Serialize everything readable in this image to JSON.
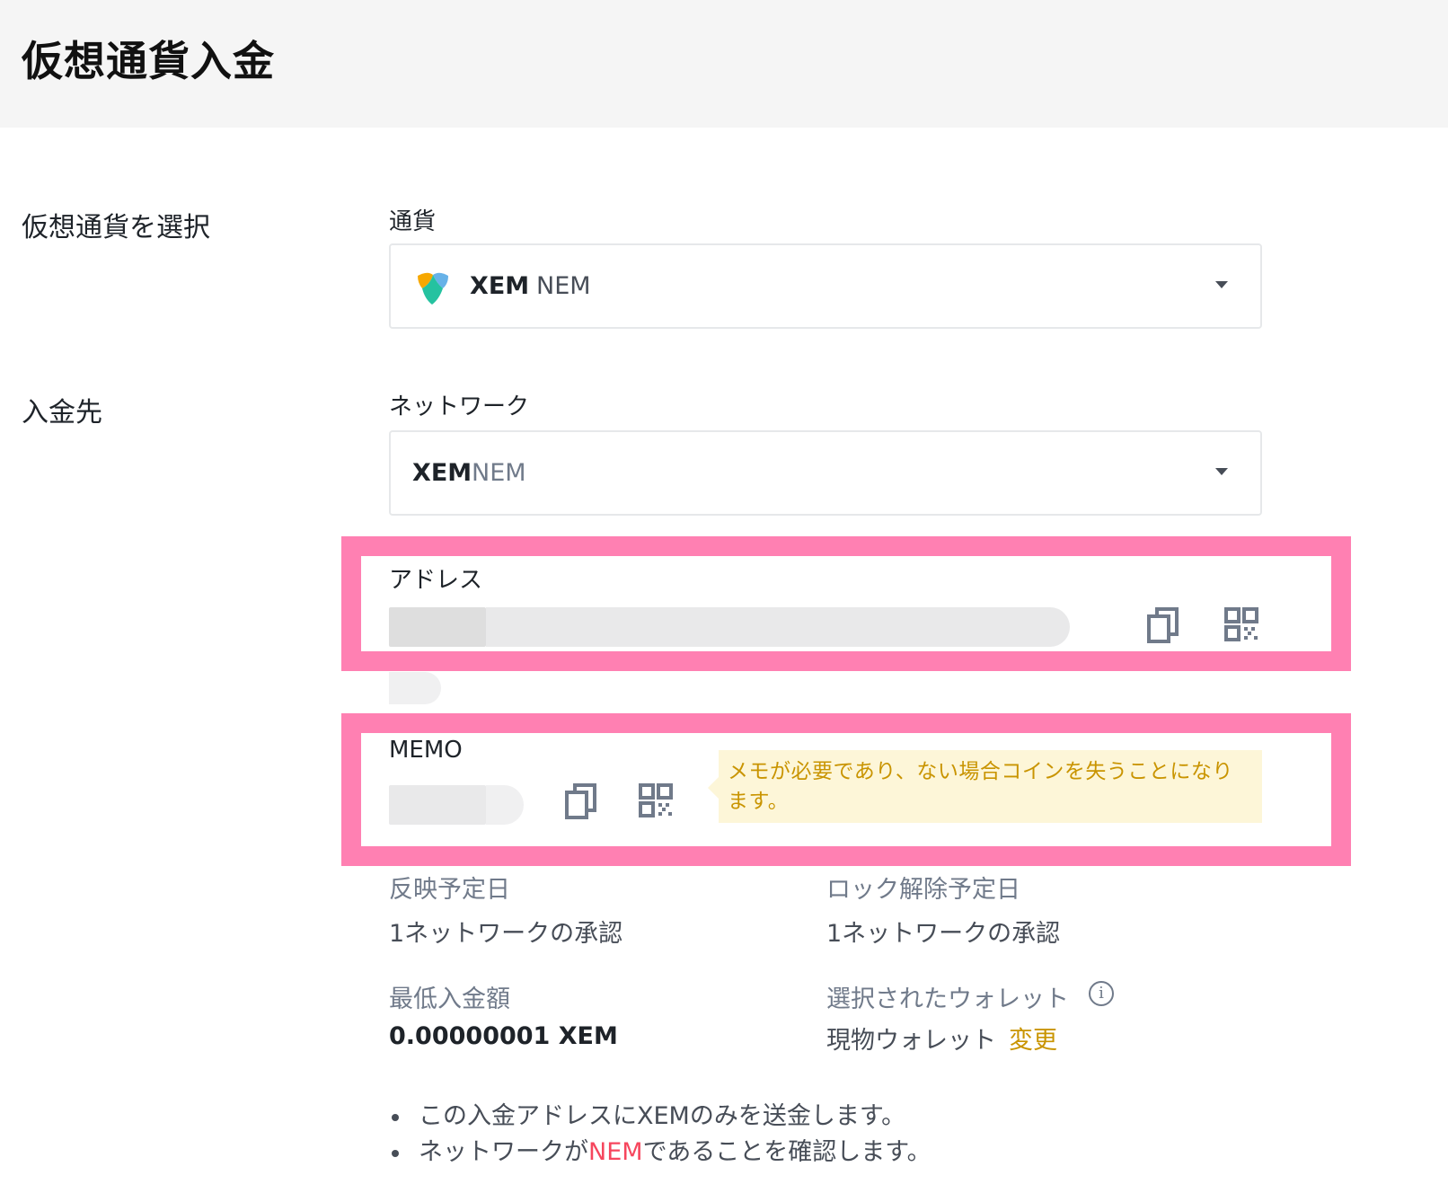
{
  "header": {
    "title": "仮想通貨入金"
  },
  "select_crypto": {
    "section_label": "仮想通貨を選択",
    "field_label": "通貨",
    "selected_code": "XEM",
    "selected_name": "NEM",
    "logo_icon": "nem-logo-icon"
  },
  "deposit_to": {
    "section_label": "入金先",
    "network_label": "ネットワーク",
    "network_code": "XEM",
    "network_name": "NEM"
  },
  "address": {
    "label": "アドレス",
    "copy_icon": "copy-icon",
    "qr_icon": "qr-code-icon"
  },
  "memo": {
    "label": "MEMO",
    "copy_icon": "copy-icon",
    "qr_icon": "qr-code-icon",
    "warning": "メモが必要であり、ない場合コインを失うことになります。"
  },
  "details": {
    "expected_arrival_label": "反映予定日",
    "expected_arrival_value": "1ネットワークの承認",
    "expected_unlock_label": "ロック解除予定日",
    "expected_unlock_value": "1ネットワークの承認",
    "min_deposit_label": "最低入金額",
    "min_deposit_value": "0.00000001 XEM",
    "selected_wallet_label": "選択されたウォレット",
    "selected_wallet_value": "現物ウォレット",
    "change_label": "変更",
    "info_icon": "info-icon"
  },
  "notes": [
    {
      "before": "この入金アドレスにXEMのみを送金します。",
      "highlight": "",
      "after": ""
    },
    {
      "before": "ネットワークが",
      "highlight": "NEM",
      "after": "であることを確認します。"
    }
  ],
  "colors": {
    "highlight_frame": "#ff80b2",
    "accent": "#c99400",
    "warning_bg": "#fdf6d8",
    "network_red": "#f6465d"
  }
}
